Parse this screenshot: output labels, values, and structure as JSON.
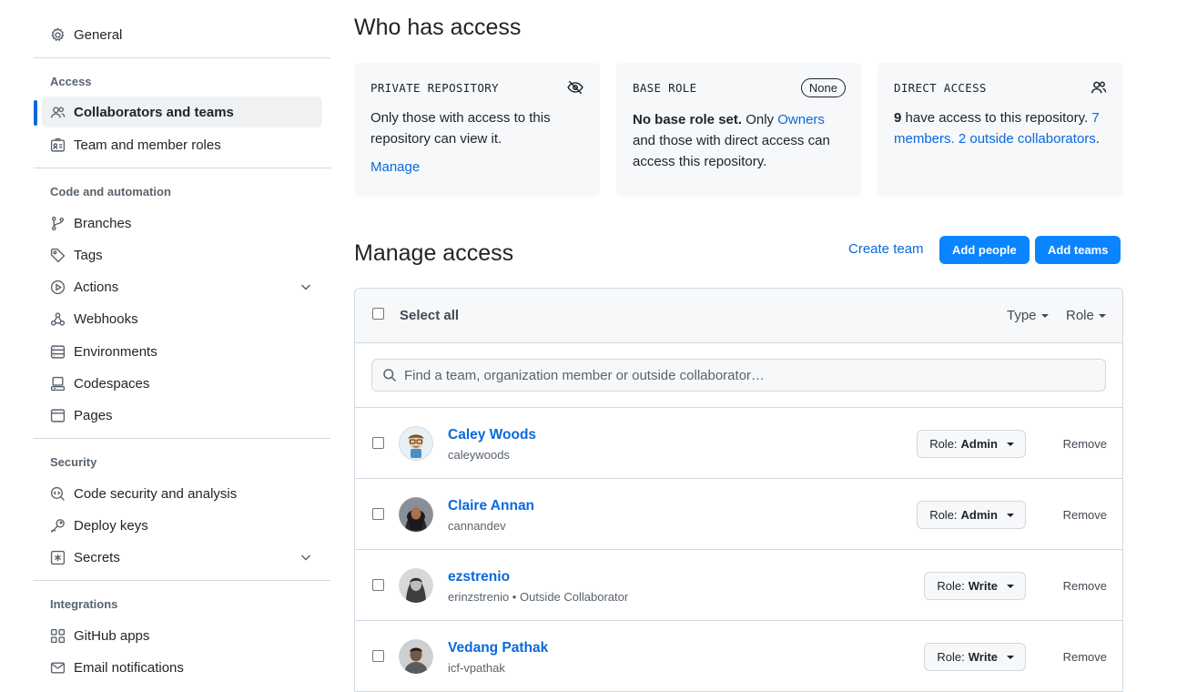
{
  "sidebar": {
    "general": "General",
    "groups": {
      "access": "Access",
      "code": "Code and automation",
      "security": "Security",
      "integrations": "Integrations"
    },
    "items": {
      "collaborators": "Collaborators and teams",
      "roles": "Team and member roles",
      "branches": "Branches",
      "tags": "Tags",
      "actions": "Actions",
      "webhooks": "Webhooks",
      "environments": "Environments",
      "codespaces": "Codespaces",
      "pages": "Pages",
      "code_security": "Code security and analysis",
      "deploy_keys": "Deploy keys",
      "secrets": "Secrets",
      "github_apps": "GitHub apps",
      "email": "Email notifications"
    }
  },
  "who": {
    "title": "Who has access",
    "private": {
      "kicker": "PRIVATE REPOSITORY",
      "text": "Only those with access to this repository can view it.",
      "link": "Manage"
    },
    "base": {
      "kicker": "BASE ROLE",
      "badge": "None",
      "bold": "No base role set.",
      "pre": "Only",
      "link": "Owners",
      "post": "and those with direct access can access this repository."
    },
    "direct": {
      "kicker": "DIRECT ACCESS",
      "count": "9",
      "text": "have access to this repository.",
      "members": "7 members.",
      "outside": "2 outside collaborators",
      "period": "."
    }
  },
  "manage": {
    "title": "Manage access",
    "create_team": "Create team",
    "add_people": "Add people",
    "add_teams": "Add teams",
    "select_all": "Select all",
    "type_filter": "Type",
    "role_filter": "Role",
    "search_placeholder": "Find a team, organization member or outside collaborator…",
    "role_prefix": "Role:",
    "remove": "Remove",
    "people": [
      {
        "name": "Caley Woods",
        "sub": "caleywoods",
        "role": "Admin"
      },
      {
        "name": "Claire Annan",
        "sub": "cannandev",
        "role": "Admin"
      },
      {
        "name": "ezstrenio",
        "sub": "erinzstrenio • Outside Collaborator",
        "role": "Write"
      },
      {
        "name": "Vedang Pathak",
        "sub": "icf-vpathak",
        "role": "Write"
      }
    ]
  },
  "colors": {
    "link": "#0969da",
    "primary": "#0a84ff",
    "active_bar": "#0969da"
  }
}
